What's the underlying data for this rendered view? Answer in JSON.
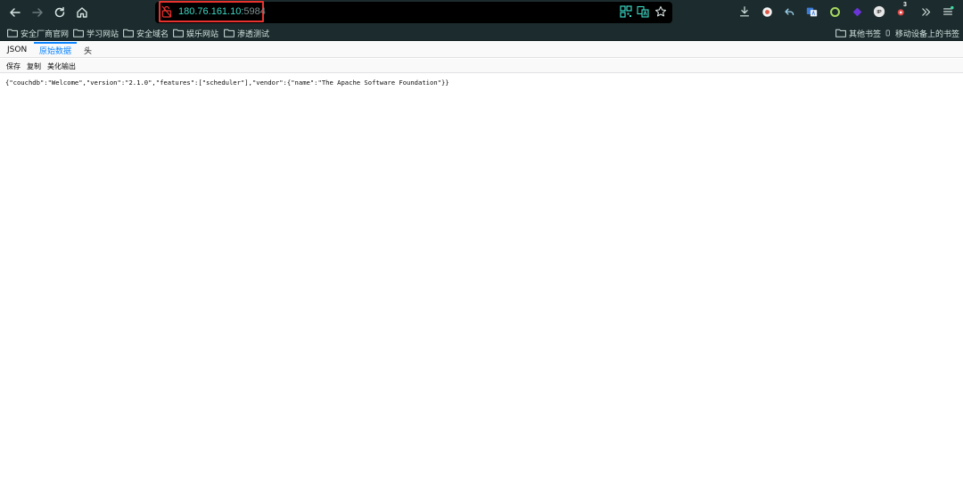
{
  "browser": {
    "url_host": "180.76.161.10:",
    "url_port": "5984",
    "notification_badge": "3",
    "ip_badge": "IP"
  },
  "bookmarks": {
    "items": [
      {
        "label": "安全厂商官网"
      },
      {
        "label": "学习网站"
      },
      {
        "label": "安全域名"
      },
      {
        "label": "娱乐网站"
      },
      {
        "label": "渗透测试"
      }
    ],
    "other_label": "其他书签",
    "mobile_label": "移动设备上的书签"
  },
  "json_viewer": {
    "tabs": [
      {
        "label": "JSON",
        "active": false
      },
      {
        "label": "原始数据",
        "active": true
      },
      {
        "label": "头",
        "active": false
      }
    ],
    "actions": {
      "save_label": "保存",
      "copy_label": "复制",
      "pretty_label": "美化输出"
    },
    "raw_text": "{\"couchdb\":\"Welcome\",\"version\":\"2.1.0\",\"features\":[\"scheduler\"],\"vendor\":{\"name\":\"The Apache Software Foundation\"}}"
  },
  "colors": {
    "toolbar_bg": "#1c2b2d",
    "url_host": "#3cd9c4",
    "url_port": "#7f8f90",
    "highlight_border": "#e8322e",
    "active_tab": "#0a84ff"
  }
}
